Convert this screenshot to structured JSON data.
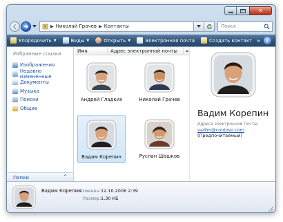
{
  "window": {
    "minimize_icon": "minimize-icon",
    "maximize_icon": "maximize-icon",
    "close_icon": "close-icon"
  },
  "address": {
    "crumbs": [
      "Николай Грачев",
      "Контакты"
    ],
    "search_placeholder": "Поиск"
  },
  "toolbar": {
    "organize": "Упорядочить",
    "views": "Виды",
    "open": "Открыть",
    "email": "Электронная почта",
    "new_contact": "Создать контакт",
    "more": "»",
    "help": "?"
  },
  "nav": {
    "title": "Избранные ссылки",
    "links": [
      "Изображения",
      "Недавно измененные",
      "Документы",
      "Музыка",
      "Поиски",
      "Общие"
    ],
    "folders_label": "Папки"
  },
  "columns": {
    "name": "Имя",
    "email": "Адрес электронной почты",
    "more": "»"
  },
  "contacts": [
    {
      "name": "Андрей Гладких"
    },
    {
      "name": "Николай Грачев"
    },
    {
      "name": "Вадим Корепин",
      "selected": true
    },
    {
      "name": "Руслан Шашков"
    }
  ],
  "preview": {
    "name": "Вадим Корепин",
    "email_label": "Адреса электронной почты:",
    "email": "vadim@contoso.com",
    "preferred": "(Предпочитаемый)"
  },
  "details": {
    "name": "Вадим Корепин",
    "modified_label": "Изменен:",
    "modified_value": "12.10.2006 2:39",
    "size_label": "Размер:",
    "size_value": "1,30 КБ"
  },
  "colors": {
    "toolbar": "#2f5278",
    "link": "#1c55a8",
    "selection": "#cfe6f8"
  }
}
